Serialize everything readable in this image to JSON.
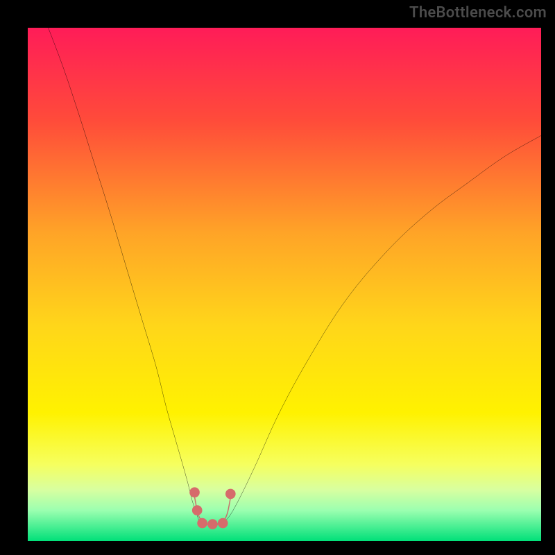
{
  "attribution": "TheBottleneck.com",
  "chart_data": {
    "type": "line",
    "title": "",
    "xlabel": "",
    "ylabel": "",
    "xlim": [
      0,
      100
    ],
    "ylim": [
      0,
      100
    ],
    "grid": false,
    "legend": false,
    "background_gradient": {
      "stops": [
        {
          "pct": 0,
          "color": "#ff1c58"
        },
        {
          "pct": 18,
          "color": "#ff4b3a"
        },
        {
          "pct": 40,
          "color": "#ffa427"
        },
        {
          "pct": 58,
          "color": "#ffd61a"
        },
        {
          "pct": 75,
          "color": "#fff200"
        },
        {
          "pct": 85,
          "color": "#f6ff5e"
        },
        {
          "pct": 90,
          "color": "#d8ffa0"
        },
        {
          "pct": 94,
          "color": "#9bffb0"
        },
        {
          "pct": 100,
          "color": "#00e079"
        }
      ]
    },
    "series": [
      {
        "name": "left-curve",
        "x": [
          4,
          7,
          10,
          13,
          16,
          19,
          22,
          25,
          27,
          29,
          31,
          32,
          33,
          33.5
        ],
        "y": [
          100,
          92,
          83,
          73.5,
          64,
          54,
          44,
          34,
          26,
          19,
          12,
          8,
          5,
          3.5
        ]
      },
      {
        "name": "right-curve",
        "x": [
          38,
          40,
          44,
          49,
          55,
          62,
          70,
          78,
          86,
          93,
          100
        ],
        "y": [
          3.5,
          6,
          14,
          25,
          36,
          47,
          56.5,
          64,
          70,
          75,
          79
        ]
      }
    ],
    "valley_floor": {
      "x": [
        33.5,
        38
      ],
      "y": [
        3.5,
        3.5
      ]
    },
    "markers": [
      {
        "name": "marker-left-upper",
        "x": 32.5,
        "y": 9.5,
        "r": 2.2,
        "color": "#d66b6b"
      },
      {
        "name": "marker-left-lower",
        "x": 33.0,
        "y": 6.0,
        "r": 2.2,
        "color": "#d66b6b"
      },
      {
        "name": "marker-bottom-1",
        "x": 34.0,
        "y": 3.5,
        "r": 2.2,
        "color": "#d66b6b"
      },
      {
        "name": "marker-bottom-2",
        "x": 36.0,
        "y": 3.3,
        "r": 2.2,
        "color": "#d66b6b"
      },
      {
        "name": "marker-bottom-3",
        "x": 38.0,
        "y": 3.5,
        "r": 2.2,
        "color": "#d66b6b"
      },
      {
        "name": "marker-right-upper",
        "x": 39.5,
        "y": 9.2,
        "r": 2.2,
        "color": "#d66b6b"
      }
    ]
  }
}
